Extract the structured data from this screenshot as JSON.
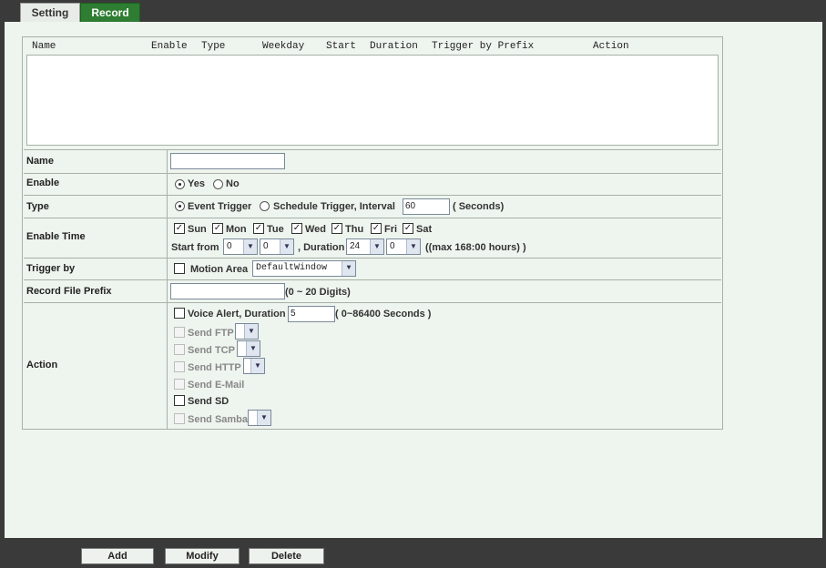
{
  "tabs": {
    "setting": "Setting",
    "record": "Record"
  },
  "list": {
    "headers": [
      "Name",
      "Enable",
      "Type",
      "Weekday",
      "Start",
      "Duration",
      "Trigger by Prefix",
      "Action"
    ]
  },
  "form": {
    "name": {
      "label": "Name",
      "value": ""
    },
    "enable": {
      "label": "Enable",
      "yes": "Yes",
      "no": "No"
    },
    "type": {
      "label": "Type",
      "event": "Event Trigger",
      "schedule": "Schedule Trigger, Interval",
      "interval": "60",
      "unit": "( Seconds)"
    },
    "enable_time": {
      "label": "Enable Time",
      "days": [
        "Sun",
        "Mon",
        "Tue",
        "Wed",
        "Thu",
        "Fri",
        "Sat"
      ],
      "start_label": "Start from",
      "start_hour": "0",
      "start_min": "0",
      "duration_label": ", Duration",
      "dur_hour": "24",
      "dur_min": "0",
      "max_note": "((max 168:00 hours) )"
    },
    "trigger_by": {
      "label": "Trigger by",
      "motion": "Motion Area",
      "window": "DefaultWindow"
    },
    "prefix": {
      "label": "Record File Prefix",
      "value": "",
      "note": "(0 ~ 20 Digits)"
    },
    "action": {
      "label": "Action",
      "voice": "Voice Alert, Duration",
      "voice_value": "5",
      "voice_note": "( 0~86400 Seconds )",
      "ftp": "Send FTP",
      "tcp": "Send TCP",
      "http": "Send HTTP",
      "email": "Send E-Mail",
      "sd": "Send SD",
      "samba": "Send Samba"
    }
  },
  "buttons": {
    "add": "Add",
    "modify": "Modify",
    "delete": "Delete"
  }
}
